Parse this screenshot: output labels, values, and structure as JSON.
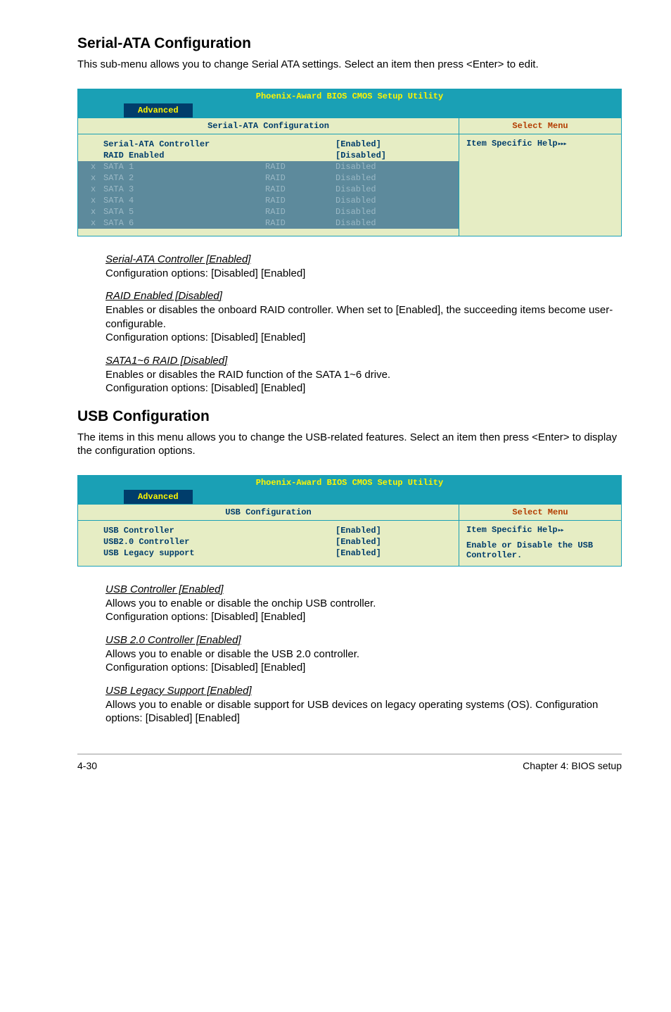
{
  "sections": {
    "serialAta": {
      "heading": "Serial-ATA Configuration",
      "intro": "This sub-menu allows you to change Serial ATA settings. Select an item then press <Enter> to edit."
    },
    "usb": {
      "heading": "USB Configuration",
      "intro": "The items in this menu allows you to change the USB-related features. Select an item then press <Enter> to display the configuration options."
    }
  },
  "bios": {
    "title": "Phoenix-Award BIOS CMOS Setup Utility",
    "tab": "Advanced",
    "selectMenu": "Select Menu",
    "helpPrefix": "Item Specific Help",
    "serial": {
      "panelTitle": "Serial-ATA Configuration",
      "rows": {
        "controller": {
          "name": "Serial-ATA Controller",
          "val": "[Enabled]"
        },
        "raid": {
          "name": "RAID Enabled",
          "val": "[Disabled]"
        }
      },
      "disabledRows": {
        "s1": {
          "prefix": "x",
          "name": "SATA 1",
          "mid": "RAID",
          "val": "Disabled"
        },
        "s2": {
          "prefix": "x",
          "name": "SATA 2",
          "mid": "RAID",
          "val": "Disabled"
        },
        "s3": {
          "prefix": "x",
          "name": "SATA 3",
          "mid": "RAID",
          "val": "Disabled"
        },
        "s4": {
          "prefix": "x",
          "name": "SATA 4",
          "mid": "RAID",
          "val": "Disabled"
        },
        "s5": {
          "prefix": "x",
          "name": "SATA 5",
          "mid": "RAID",
          "val": "Disabled"
        },
        "s6": {
          "prefix": "x",
          "name": "SATA 6",
          "mid": "RAID",
          "val": "Disabled"
        }
      }
    },
    "usb": {
      "panelTitle": "USB Configuration",
      "helpText": "Enable or Disable the USB Controller.",
      "rows": {
        "ctrl": {
          "name": "USB Controller",
          "val": "[Enabled]"
        },
        "ctrl2": {
          "name": "USB2.0 Controller",
          "val": "[Enabled]"
        },
        "legacy": {
          "name": "USB Legacy support",
          "val": "[Enabled]"
        }
      }
    }
  },
  "params": {
    "serialController": {
      "title": "Serial-ATA Controller [Enabled]",
      "body": "Configuration options: [Disabled] [Enabled]"
    },
    "raidEnabled": {
      "title": "RAID Enabled [Disabled]",
      "body": "Enables or disables the onboard RAID controller. When set to [Enabled], the succeeding items become user-configurable.\nConfiguration options: [Disabled] [Enabled]"
    },
    "sataRaid": {
      "title": "SATA1~6  RAID [Disabled]",
      "body": "Enables or disables the RAID function of the SATA 1~6 drive.\nConfiguration options: [Disabled] [Enabled]"
    },
    "usbController": {
      "title": "USB Controller [Enabled]",
      "body": "Allows you to enable or disable the onchip USB controller.\nConfiguration options: [Disabled] [Enabled]"
    },
    "usb20": {
      "title": "USB 2.0 Controller [Enabled]",
      "body": "Allows you to enable or disable the USB 2.0 controller.\nConfiguration options: [Disabled] [Enabled]"
    },
    "usbLegacy": {
      "title": "USB Legacy Support [Enabled]",
      "body": "Allows you to enable or disable support for USB devices on legacy operating systems (OS). Configuration options: [Disabled] [Enabled]"
    }
  },
  "footer": {
    "pageNum": "4-30",
    "chapter": "Chapter 4: BIOS setup"
  }
}
